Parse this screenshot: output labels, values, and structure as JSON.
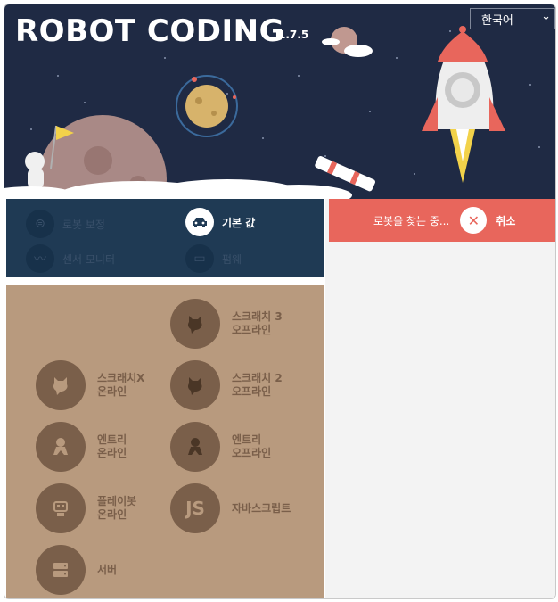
{
  "header": {
    "title": "ROBOT CODING",
    "version": "1.7.5",
    "language": "한국어"
  },
  "menu": {
    "items": [
      {
        "label": "로봇 보정",
        "icon": "calibrate-icon"
      },
      {
        "label": "기본 값",
        "icon": "car-icon"
      },
      {
        "label": "센서 모니터",
        "icon": "chart-icon"
      },
      {
        "label": "펌웨",
        "icon": "firmware-icon"
      }
    ],
    "active": "기본 값"
  },
  "apps": [
    {
      "line1": "스크래치 3",
      "line2": "오프라인",
      "icon": "scratch-cat-icon"
    },
    {
      "line1": "스크래치X",
      "line2": "온라인",
      "icon": "scratch-cat-icon"
    },
    {
      "line1": "스크래치 2",
      "line2": "오프라인",
      "icon": "scratch-cat-icon"
    },
    {
      "line1": "엔트리",
      "line2": "온라인",
      "icon": "entry-icon"
    },
    {
      "line1": "엔트리",
      "line2": "오프라인",
      "icon": "entry-icon"
    },
    {
      "line1": "플레이봇",
      "line2": "온라인",
      "icon": "playbot-icon"
    },
    {
      "line1": "자바스크립트",
      "line2": "",
      "icon_text": "JS"
    },
    {
      "line1": "서버",
      "line2": "",
      "icon": "server-icon"
    }
  ],
  "status": {
    "text": "로봇을 찾는 중...",
    "cancel_label": "취소"
  },
  "colors": {
    "hero_bg": "#1f2a44",
    "menu_bg": "#1f3a54",
    "apps_bg": "#b89a7e",
    "status_bg": "#e8665c"
  }
}
